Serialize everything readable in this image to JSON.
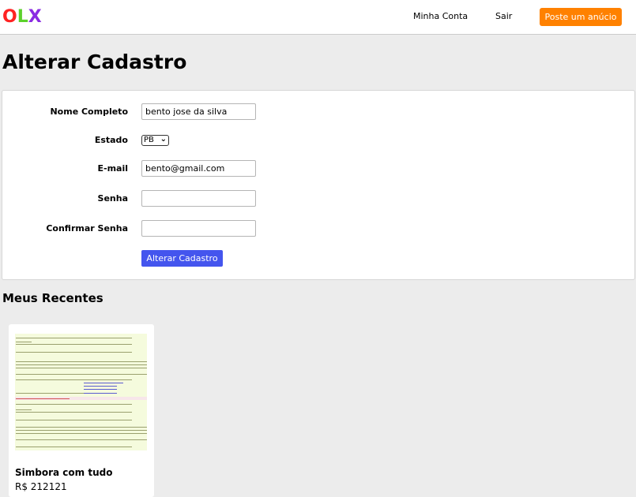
{
  "header": {
    "logo": [
      "O",
      "L",
      "X"
    ],
    "logo_colors": [
      "#ff2222",
      "#5cd12c",
      "#8a2be2"
    ],
    "nav_account": "Minha Conta",
    "nav_logout": "Sair",
    "post_button": "Poste um anúcio"
  },
  "page_title": "Alterar Cadastro",
  "form": {
    "name_label": "Nome Completo",
    "name_value": "bento jose da silva",
    "state_label": "Estado",
    "state_value": "PB",
    "email_label": "E-mail",
    "email_value": "bento@gmail.com",
    "password_label": "Senha",
    "password_value": "",
    "confirm_label": "Confirmar Senha",
    "confirm_value": "",
    "submit_label": "Alterar Cadastro"
  },
  "recent": {
    "title": "Meus Recentes",
    "items": [
      {
        "title": "Simbora com tudo",
        "price": "R$ 212121"
      }
    ]
  },
  "colors": {
    "accent_orange": "#ff8100",
    "button_blue": "#4455ee"
  }
}
